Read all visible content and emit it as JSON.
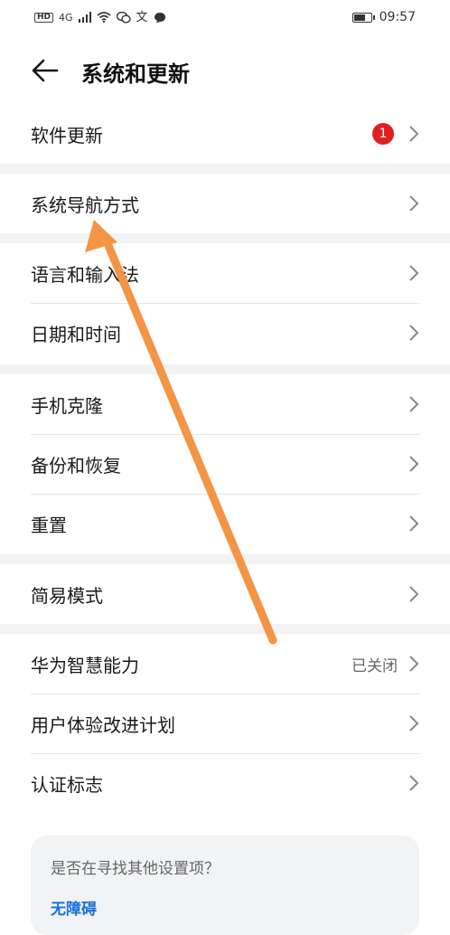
{
  "status_bar": {
    "hd": "HD",
    "network": "4G",
    "wechat_icon": "wechat-icon",
    "translate_glyph": "文",
    "message_icon": "chat-bubble-icon",
    "battery_level": 0.75,
    "time": "09:57"
  },
  "header": {
    "back_icon": "arrow-left-icon",
    "title": "系统和更新"
  },
  "groups": [
    {
      "items": [
        {
          "label": "软件更新",
          "badge": "1"
        }
      ]
    },
    {
      "items": [
        {
          "label": "系统导航方式"
        }
      ]
    },
    {
      "items": [
        {
          "label": "语言和输入法"
        },
        {
          "label": "日期和时间"
        }
      ]
    },
    {
      "items": [
        {
          "label": "手机克隆"
        },
        {
          "label": "备份和恢复"
        },
        {
          "label": "重置"
        }
      ]
    },
    {
      "items": [
        {
          "label": "简易模式"
        }
      ]
    },
    {
      "items": [
        {
          "label": "华为智慧能力",
          "value": "已关闭"
        },
        {
          "label": "用户体验改进计划"
        },
        {
          "label": "认证标志"
        }
      ]
    }
  ],
  "suggest": {
    "title": "是否在寻找其他设置项？",
    "link": "无障碍"
  },
  "colors": {
    "badge": "#e02020",
    "link": "#1a73d9",
    "annotation_arrow": "#f39545",
    "separator": "#f1f3f5"
  }
}
